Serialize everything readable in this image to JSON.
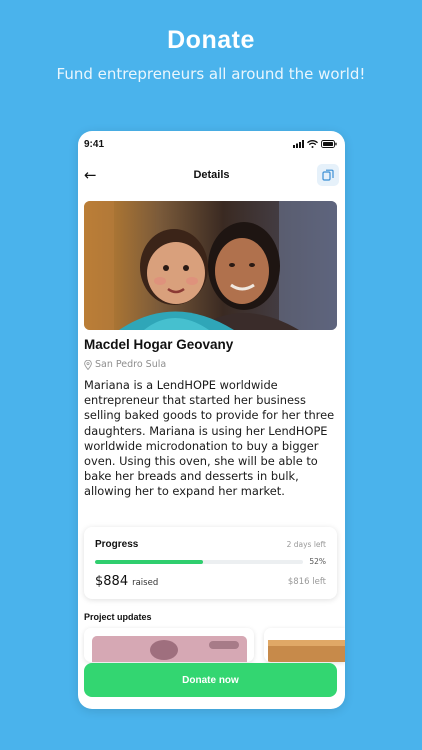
{
  "promo": {
    "title": "Donate",
    "subtitle": "Fund entrepreneurs all around the world!"
  },
  "status_bar": {
    "time": "9:41",
    "icons": [
      "signal-icon",
      "wifi-icon",
      "battery-icon"
    ]
  },
  "nav": {
    "back_icon": "arrow-left-icon",
    "title": "Details",
    "share_icon": "copy-icon"
  },
  "project": {
    "title": "Macdel Hogar Geovany",
    "location": "San Pedro Sula",
    "description": "Mariana is a LendHOPE worldwide entrepreneur that started her business selling baked goods to provide for her three daughters. Mariana is using her LendHOPE worldwide microdonation to buy a bigger oven. Using this oven, she will be able to bake her breads and desserts in bulk, allowing her to expand her market."
  },
  "progress": {
    "label": "Progress",
    "time_left": "2 days left",
    "percent_label": "52%",
    "percent": 0.52,
    "raised_amount": "$884",
    "raised_label": "raised",
    "remaining": "$816 left"
  },
  "updates": {
    "title": "Project updates"
  },
  "donate_button": {
    "label": "Donate now"
  },
  "colors": {
    "background": "#4ab3ec",
    "accent_green": "#33d671",
    "progress_green": "#2fce6e"
  }
}
